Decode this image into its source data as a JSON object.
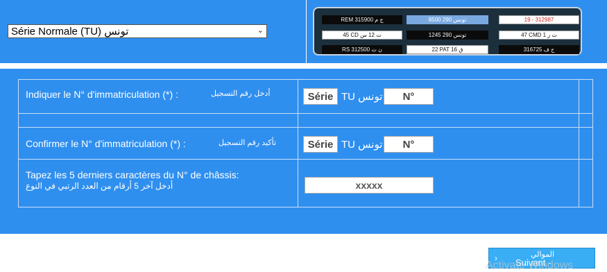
{
  "series_select": {
    "selected": "Série Normale (TU) تونس"
  },
  "plates": [
    {
      "text": "REM 315900 ج م",
      "style": "dark"
    },
    {
      "text": "8500 تونس 290",
      "style": "blue"
    },
    {
      "text": "19 - 312987",
      "style": "red"
    },
    {
      "text": "45 CD ت 12 س",
      "style": "light"
    },
    {
      "text": "1245 تونس 290",
      "style": "dark"
    },
    {
      "text": "47 CMD ت ر 1",
      "style": "light"
    },
    {
      "text": "RS 312500 ن ت",
      "style": "dark"
    },
    {
      "text": "22 PAT ق 16",
      "style": "light"
    },
    {
      "text": "ح ف 316725",
      "style": "dark"
    }
  ],
  "rows": {
    "indicate": {
      "label_fr": "Indiquer le N° d'immatriculation (*) :",
      "label_ar": "أدخل رقم التسجيل",
      "serie": "Série",
      "tu": "TU تونس",
      "num": "N°"
    },
    "confirm": {
      "label_fr": "Confirmer le N° d'immatriculation (*) :",
      "label_ar": "تأكيد رقم التسجيل",
      "serie": "Série",
      "tu": "TU تونس",
      "num": "N°"
    },
    "chassis": {
      "label_fr": "Tapez les 5 derniers caractères du N° de châssis:",
      "label_ar": "أدخل آخر 5 أرقام من العدد الرتبي في النوع",
      "value": "xxxxx"
    }
  },
  "next_button": {
    "label_ar": "الموالي",
    "label_fr": "Suivant -"
  },
  "watermark": "Activate Windows",
  "colors": {
    "panel_blue": "#2f8fef",
    "button_blue": "#3aaef5",
    "plates_bg": "#1c2f3d"
  }
}
